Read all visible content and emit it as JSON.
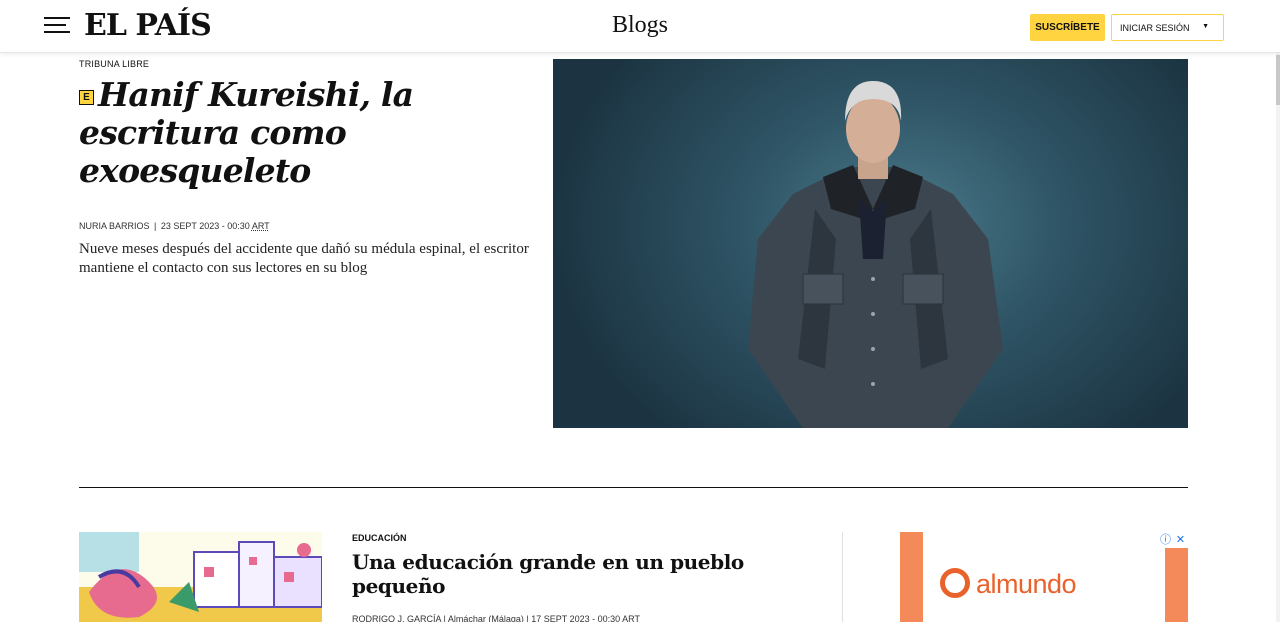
{
  "header": {
    "logo_text": "EL PAÍS",
    "section_title": "Blogs",
    "subscribe_label": "SUSCRÍBETE",
    "login_label": "INICIAR SESIÓN",
    "login_caret": "▼"
  },
  "main_article": {
    "kicker": "TRIBUNA LIBRE",
    "badge": "E",
    "headline": "Hanif Kureishi, la escritura como exoesqueleto",
    "author": "NURIA BARRIOS",
    "separator": "|",
    "date": "23 SEPT 2023 - 00:30",
    "timezone": "ART",
    "summary": "Nueve meses después del accidente que dañó su médula espinal, el escritor mantiene el contacto con sus lectores en su blog"
  },
  "second_article": {
    "kicker": "EDUCACIÓN",
    "headline": "Una educación grande en un pueblo pequeño",
    "byline": "RODRIGO J. GARCÍA | Almáchar (Málaga) | 17 SEPT 2023 - 00:30 ART"
  },
  "ad": {
    "brand": "almundo",
    "info_icon": "ⓘ",
    "close_icon": "✕"
  },
  "colors": {
    "accent_yellow": "#ffd440",
    "ad_orange": "#f4895a",
    "ad_brand": "#e9622b",
    "hero_bg": "#2f5566"
  }
}
